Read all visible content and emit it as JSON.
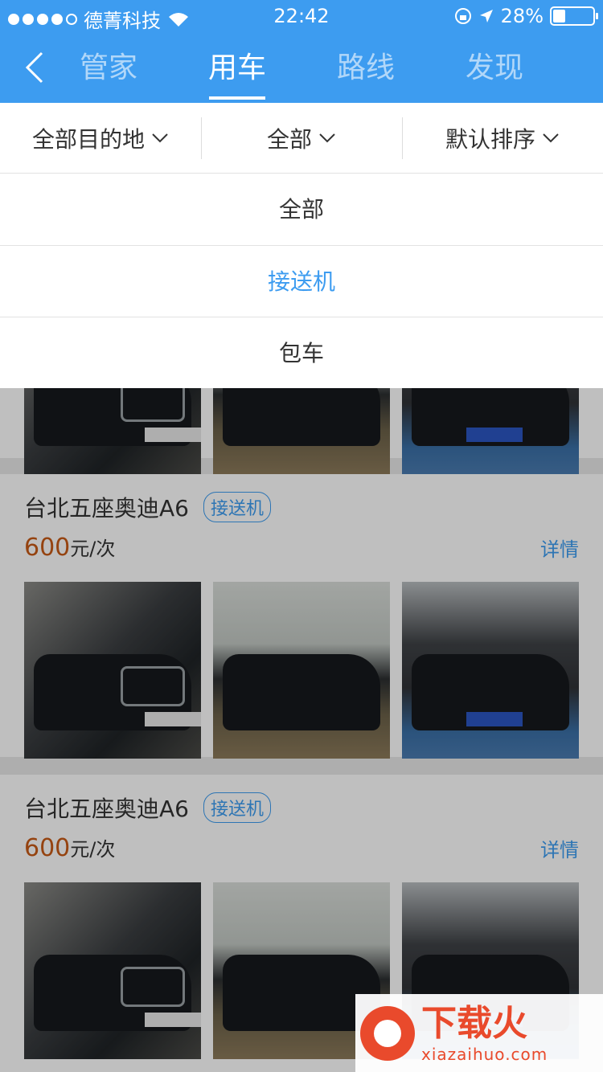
{
  "status_bar": {
    "carrier": "德菁科技",
    "time": "22:42",
    "battery": "28%"
  },
  "nav": {
    "tabs": [
      {
        "label": "管家"
      },
      {
        "label": "用车"
      },
      {
        "label": "路线"
      },
      {
        "label": "发现"
      }
    ],
    "active_tab": "用车"
  },
  "filters": [
    {
      "label": "全部目的地"
    },
    {
      "label": "全部"
    },
    {
      "label": "默认排序"
    }
  ],
  "dropdown": {
    "options": [
      {
        "label": "全部"
      },
      {
        "label": "接送机"
      },
      {
        "label": "包车"
      }
    ],
    "selected": "接送机"
  },
  "cars": [
    {
      "title": "台北五座奥迪A6",
      "tag": "接送机",
      "price": "600",
      "unit": "元/次",
      "details": "详情"
    },
    {
      "title": "台北五座奥迪A6",
      "tag": "接送机",
      "price": "600",
      "unit": "元/次",
      "details": "详情"
    }
  ],
  "watermark": {
    "text": "下载火",
    "url": "xiazaihuo.com"
  },
  "colors": {
    "primary": "#3d9cf0",
    "price": "#c75a16"
  }
}
